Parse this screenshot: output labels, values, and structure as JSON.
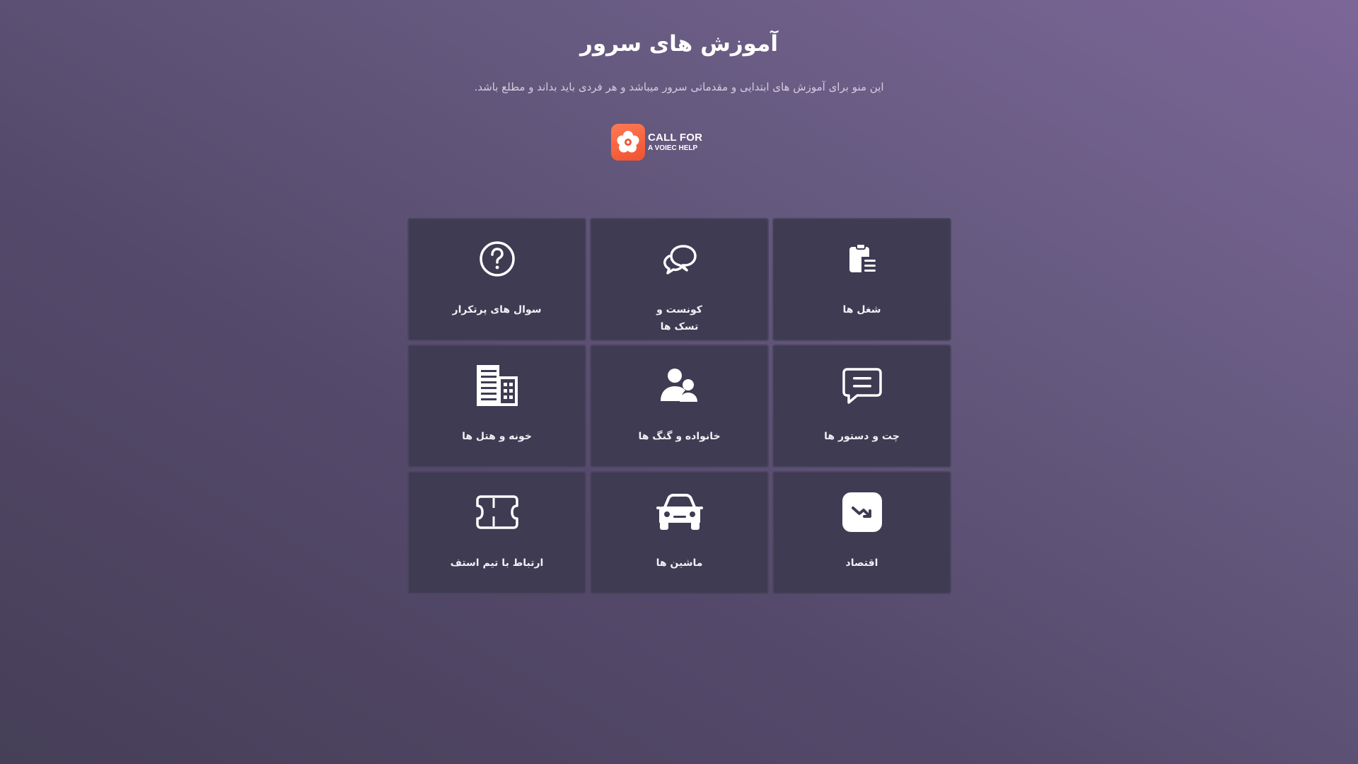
{
  "header": {
    "title": "آموزش های سرور",
    "subtitle": "این منو برای آموزش های ابتدایی و مقدماتی سرور میباشد و هر فردی باید بداند و مطلع باشد."
  },
  "call_button": {
    "line1": "CALL FOR",
    "line2": "A VOIEC HELP",
    "icon": "flower-logo-icon",
    "color": "#f25a35"
  },
  "cards": [
    {
      "label": "شغل ها",
      "icon": "clipboard-list-icon"
    },
    {
      "label": "کونست و\nتسک ها",
      "icon": "chat-bubbles-icon"
    },
    {
      "label": "سوال های پرتکرار",
      "icon": "question-circle-icon"
    },
    {
      "label": "چت و دستور ها",
      "icon": "message-square-icon"
    },
    {
      "label": "خانواده و گنگ ها",
      "icon": "users-icon"
    },
    {
      "label": "خونه و هتل ها",
      "icon": "building-icon"
    },
    {
      "label": "اقتصاد",
      "icon": "trend-down-icon"
    },
    {
      "label": "ماشین ها",
      "icon": "car-icon"
    },
    {
      "label": "ارتباط با تیم استف",
      "icon": "ticket-icon"
    }
  ],
  "colors": {
    "card_background": "#3f3b52",
    "accent": "#f25a35"
  }
}
